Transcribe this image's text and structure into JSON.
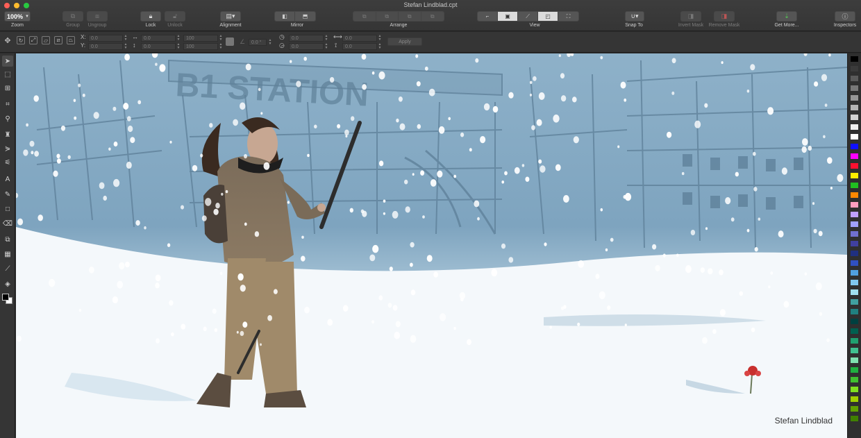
{
  "window": {
    "title": "Stefan Lindblad.cpt"
  },
  "toolbar": {
    "zoom_value": "100%",
    "labels": {
      "zoom": "Zoom",
      "group": "Group",
      "ungroup": "Ungroup",
      "lock": "Lock",
      "unlock": "Unlock",
      "alignment": "Alignment",
      "mirror": "Mirror",
      "arrange": "Arrange",
      "view": "View",
      "snap_to": "Snap To",
      "invert_mask": "Invert Mask",
      "remove_mask": "Remove Mask",
      "get_more": "Get More...",
      "inspectors": "Inspectors"
    }
  },
  "propbar": {
    "x_label": "X:",
    "y_label": "Y:",
    "x_value": "0.0",
    "y_value": "0.0",
    "w_value": "0.0",
    "h_value": "0.0",
    "scale_w": "100",
    "scale_h": "100",
    "angle": "0.0 °",
    "skew_h": "0.0",
    "skew_v": "0.0",
    "dist_h": "0.0",
    "dist_v": "0.0",
    "apply": "Apply"
  },
  "canvas": {
    "signature": "Stefan Lindblad",
    "sign_text": "B1 STATION"
  },
  "palette": {
    "colors": [
      "#000000",
      "#3a3a3a",
      "#5a5a5a",
      "#787878",
      "#969696",
      "#b4b4b4",
      "#d2d2d2",
      "#f0f0f0",
      "#ffffff",
      "#1010ff",
      "#ff00ff",
      "#ff1030",
      "#ffee00",
      "#20c020",
      "#ff8800",
      "#ff9ec0",
      "#c0a0ff",
      "#a0a0ff",
      "#7070d0",
      "#4040a0",
      "#203080",
      "#3050c0",
      "#50a0e0",
      "#80c8f0",
      "#a0e0f0",
      "#40a0a0",
      "#208080",
      "#004040",
      "#006050",
      "#20a070",
      "#40c090",
      "#80e0b0",
      "#20b040",
      "#40c030",
      "#80e020",
      "#a0d000",
      "#60a000",
      "#408000"
    ]
  }
}
